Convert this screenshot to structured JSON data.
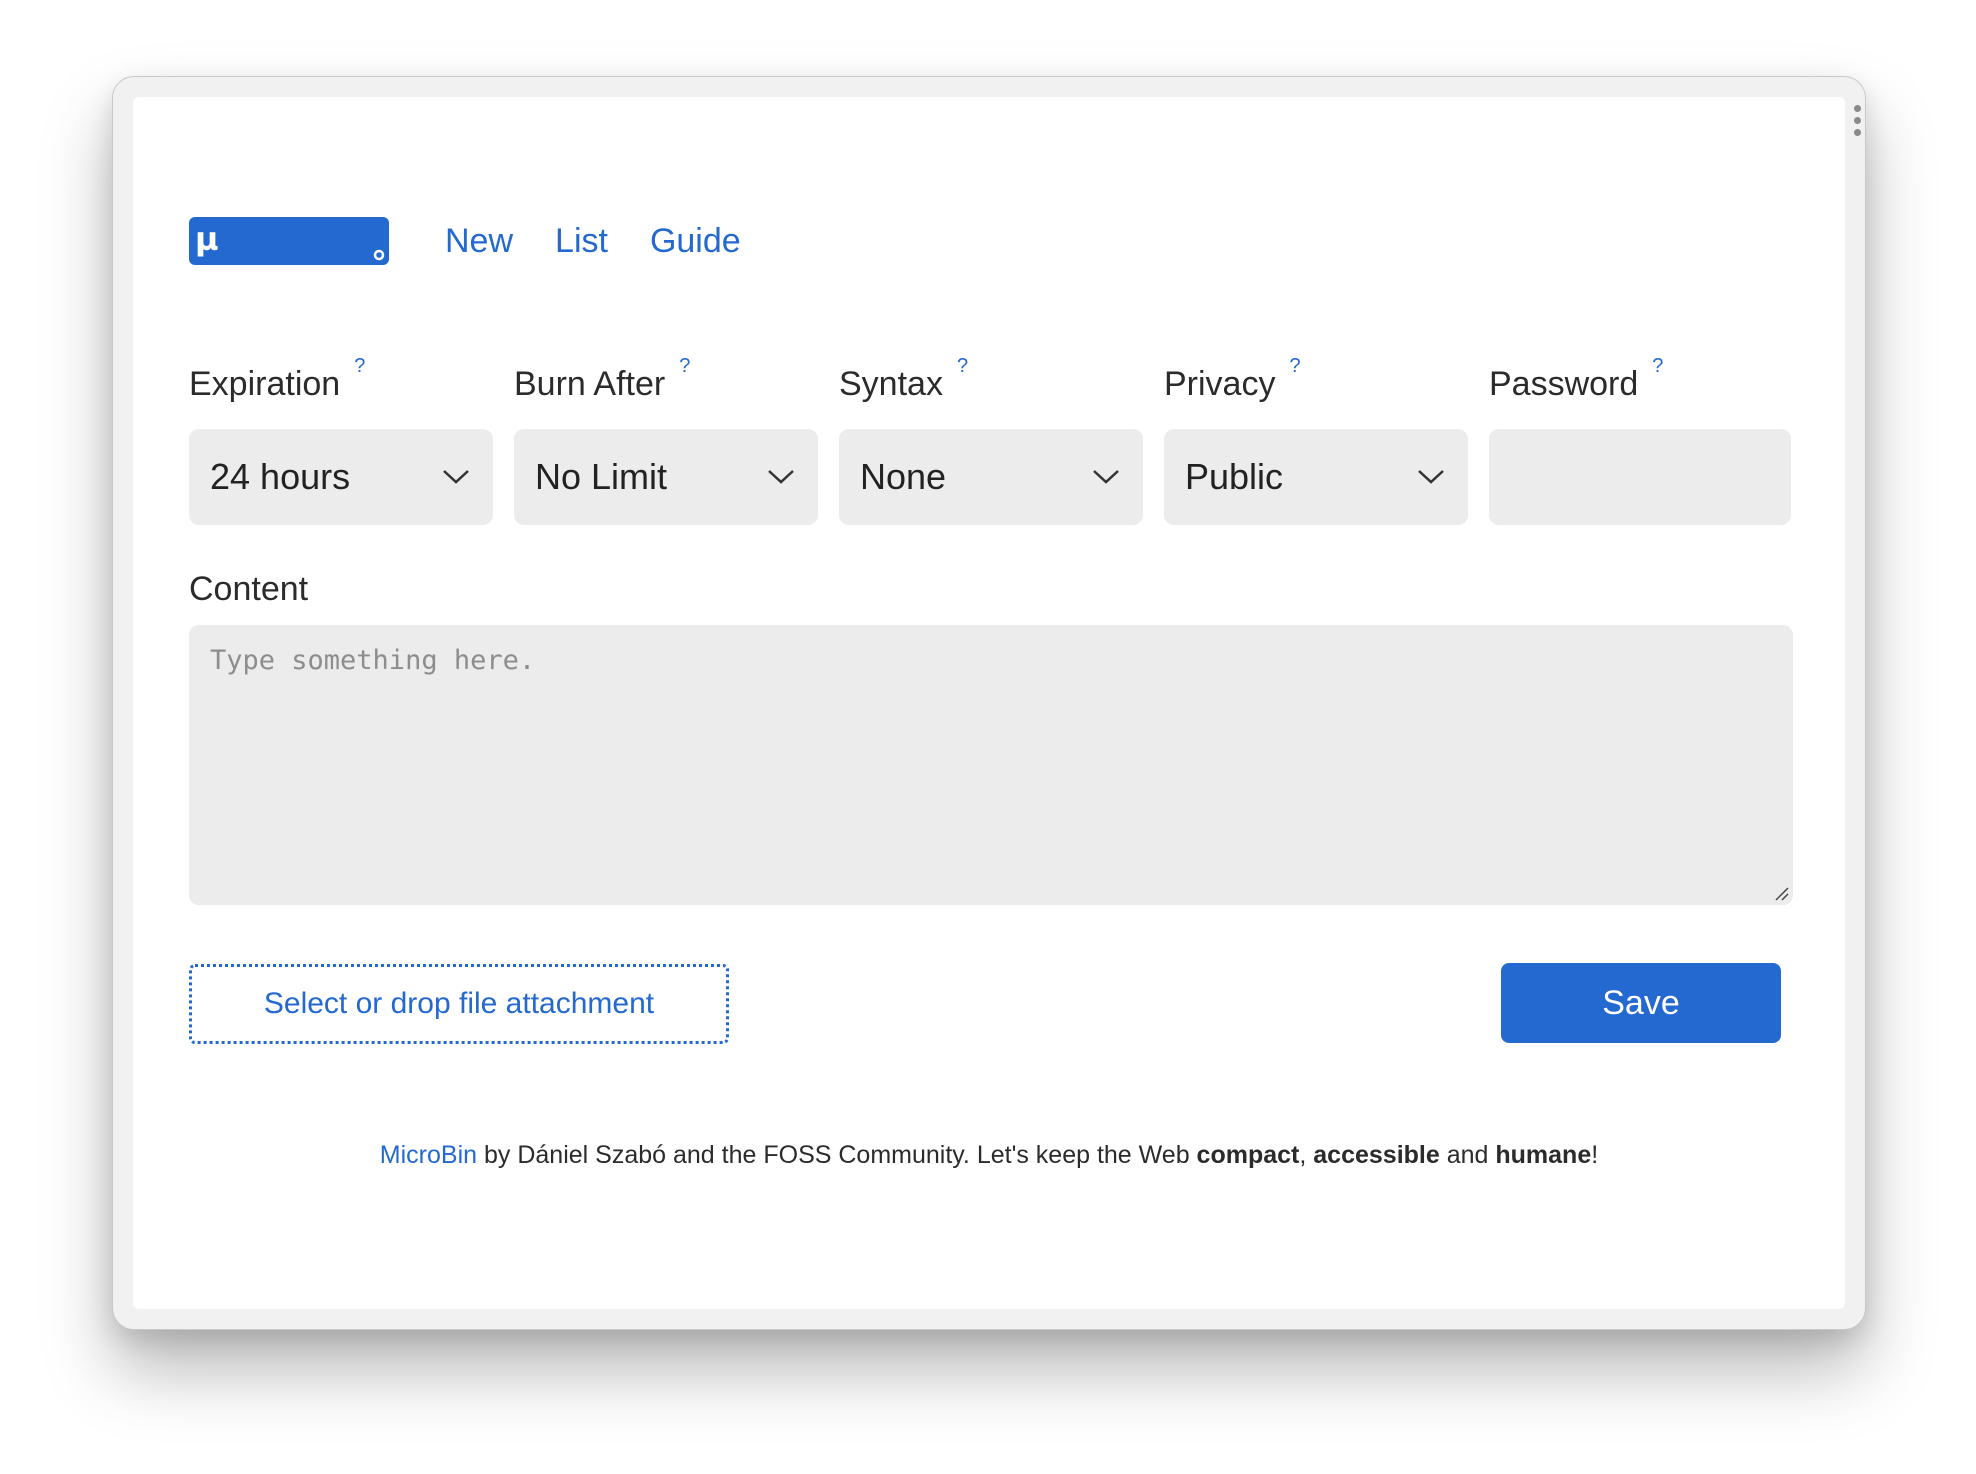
{
  "nav": {
    "logo_glyph": "µ",
    "links": [
      "New",
      "List",
      "Guide"
    ]
  },
  "options": {
    "help_glyph": "?",
    "expiration": {
      "label": "Expiration",
      "value": "24 hours"
    },
    "burn_after": {
      "label": "Burn After",
      "value": "No Limit"
    },
    "syntax": {
      "label": "Syntax",
      "value": "None"
    },
    "privacy": {
      "label": "Privacy",
      "value": "Public"
    },
    "password": {
      "label": "Password",
      "value": ""
    }
  },
  "content": {
    "label": "Content",
    "placeholder": "Type something here.",
    "value": ""
  },
  "attachment": {
    "label": "Select or drop file attachment"
  },
  "save": {
    "label": "Save"
  },
  "footer": {
    "link": "MicroBin",
    "text1": " by Dániel Szabó and the FOSS Community. Let's keep the Web ",
    "bold1": "compact",
    "sep1": ", ",
    "bold2": "accessible",
    "sep2": " and ",
    "bold3": "humane",
    "end": "!"
  },
  "colors": {
    "accent": "#2469d0",
    "field_bg": "#ececec",
    "text": "#2b2b2b"
  },
  "icons": [
    "microbin-logo-icon",
    "help-icon",
    "chevron-down-icon",
    "resize-handle-icon",
    "window-menu-icon"
  ]
}
